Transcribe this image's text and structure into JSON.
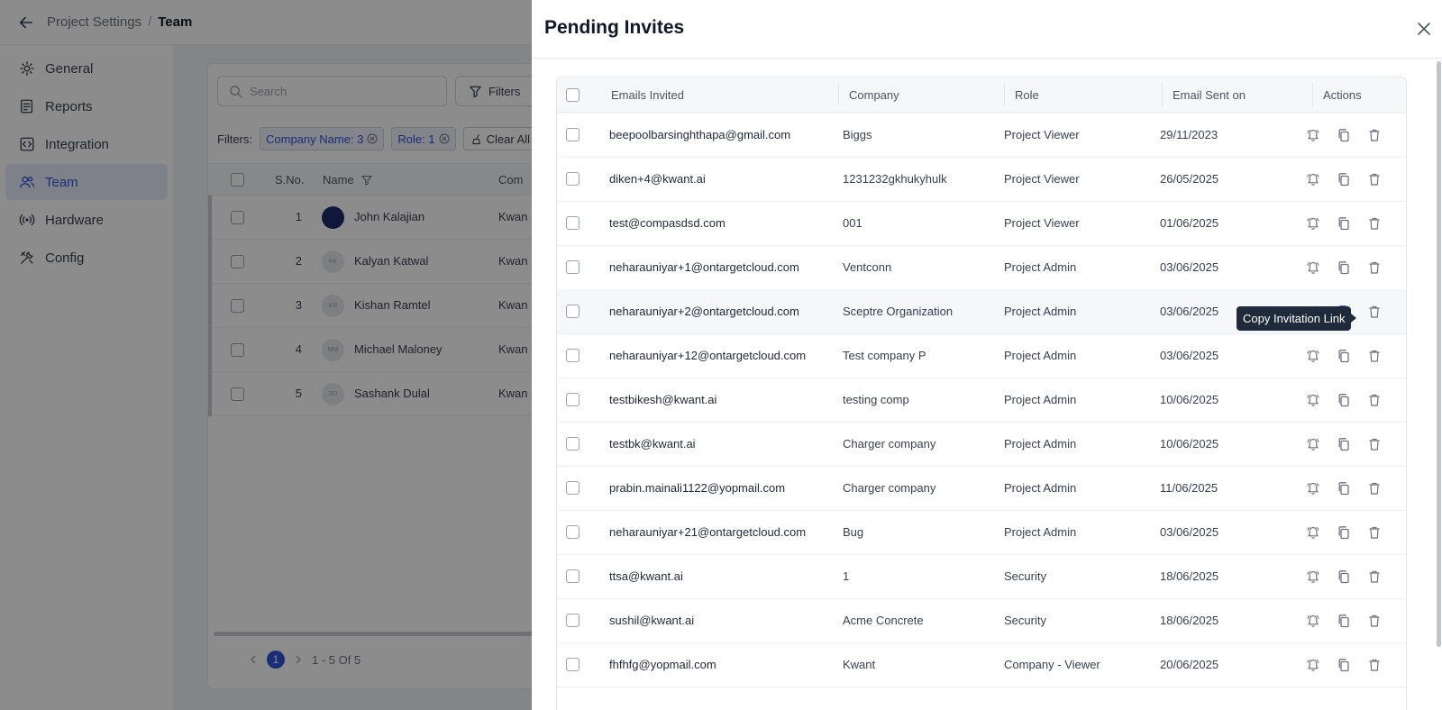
{
  "breadcrumb": {
    "parent": "Project Settings",
    "separator": "/",
    "current": "Team"
  },
  "sidebar": {
    "items": [
      {
        "label": "General",
        "icon": "gear-icon",
        "active": false
      },
      {
        "label": "Reports",
        "icon": "report-icon",
        "active": false
      },
      {
        "label": "Integration",
        "icon": "integration-icon",
        "active": false
      },
      {
        "label": "Team",
        "icon": "users-icon",
        "active": true
      },
      {
        "label": "Hardware",
        "icon": "broadcast-icon",
        "active": false
      },
      {
        "label": "Config",
        "icon": "tools-icon",
        "active": false
      }
    ]
  },
  "team": {
    "search_placeholder": "Search",
    "filters_label": "Filters",
    "filter_prefix": "Filters:",
    "chips": [
      "Company Name: 3",
      "Role: 1"
    ],
    "clear_all": "Clear All",
    "columns": {
      "sno": "S.No.",
      "name": "Name",
      "company": "Com"
    },
    "rows": [
      {
        "sno": "1",
        "initials": "",
        "name": "John Kalajian",
        "company": "Kwan"
      },
      {
        "sno": "2",
        "initials": "KK",
        "name": "Kalyan Katwal",
        "company": "Kwan"
      },
      {
        "sno": "3",
        "initials": "KR",
        "name": "Kishan Ramtel",
        "company": "Kwan"
      },
      {
        "sno": "4",
        "initials": "MM",
        "name": "Michael Maloney",
        "company": "Kwan"
      },
      {
        "sno": "5",
        "initials": "SD",
        "name": "Sashank Dulal",
        "company": "Kwan"
      }
    ],
    "pager": {
      "page": "1",
      "range": "1 - 5 Of 5"
    }
  },
  "drawer": {
    "title": "Pending Invites",
    "columns": {
      "email": "Emails Invited",
      "company": "Company",
      "role": "Role",
      "sent": "Email Sent on",
      "actions": "Actions"
    },
    "rows": [
      {
        "email": "beepoolbarsinghthapa@gmail.com",
        "company": "Biggs",
        "role": "Project Viewer",
        "sent": "29/11/2023"
      },
      {
        "email": "diken+4@kwant.ai",
        "company": "1231232gkhukyhulk",
        "role": "Project Viewer",
        "sent": "26/05/2025"
      },
      {
        "email": "test@compasdsd.com",
        "company": "001",
        "role": "Project Viewer",
        "sent": "01/06/2025"
      },
      {
        "email": "neharauniyar+1@ontargetcloud.com",
        "company": "Ventconn",
        "role": "Project Admin",
        "sent": "03/06/2025"
      },
      {
        "email": "neharauniyar+2@ontargetcloud.com",
        "company": "Sceptre Organization",
        "role": "Project Admin",
        "sent": "03/06/2025"
      },
      {
        "email": "neharauniyar+12@ontargetcloud.com",
        "company": "Test company P",
        "role": "Project Admin",
        "sent": "03/06/2025"
      },
      {
        "email": "testbikesh@kwant.ai",
        "company": "testing comp",
        "role": "Project Admin",
        "sent": "10/06/2025"
      },
      {
        "email": "testbk@kwant.ai",
        "company": "Charger company",
        "role": "Project Admin",
        "sent": "10/06/2025"
      },
      {
        "email": "prabin.mainali1122@yopmail.com",
        "company": "Charger company",
        "role": "Project Admin",
        "sent": "11/06/2025"
      },
      {
        "email": "neharauniyar+21@ontargetcloud.com",
        "company": "Bug",
        "role": "Project Admin",
        "sent": "03/06/2025"
      },
      {
        "email": "ttsa@kwant.ai",
        "company": "1",
        "role": "Security",
        "sent": "18/06/2025"
      },
      {
        "email": "sushil@kwant.ai",
        "company": "Acme Concrete",
        "role": "Security",
        "sent": "18/06/2025"
      },
      {
        "email": "fhfhfg@yopmail.com",
        "company": "Kwant",
        "role": "Company - Viewer",
        "sent": "20/06/2025"
      }
    ],
    "tooltip": "Copy Invitation Link"
  },
  "colors": {
    "accent": "#2f54d6",
    "tooltip_bg": "#1f2a3a"
  }
}
